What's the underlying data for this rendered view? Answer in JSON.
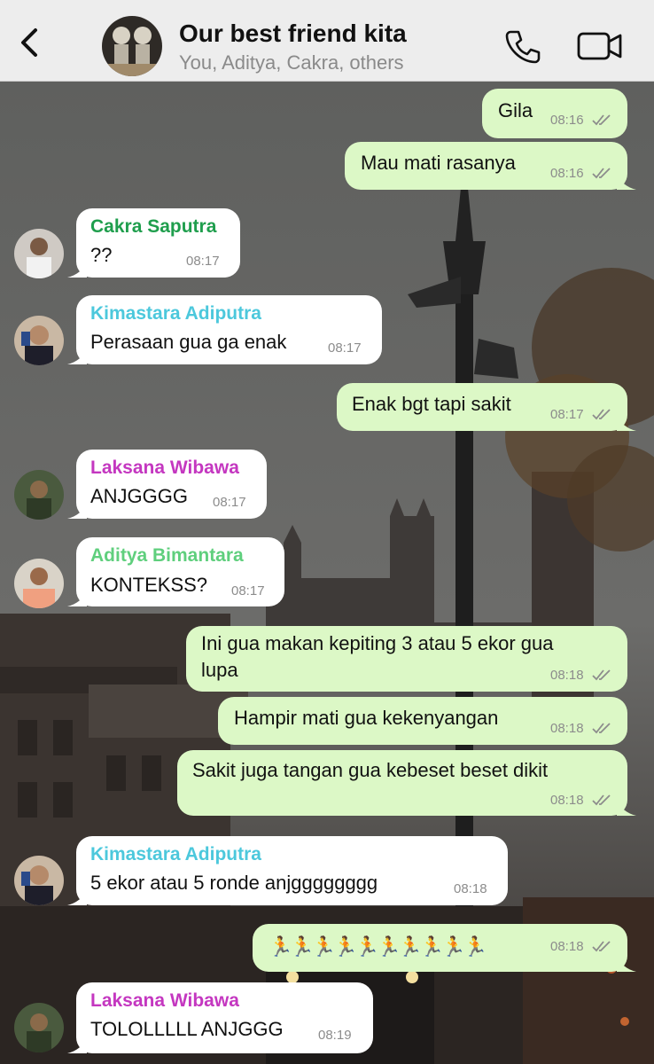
{
  "header": {
    "title": "Our best friend kita",
    "subtitle": "You, Aditya, Cakra, others",
    "icons": [
      "chevron-left-icon",
      "group-avatar",
      "phone-icon",
      "video-camera-icon"
    ]
  },
  "colors": {
    "header_bg": "#ededed",
    "outgoing_bubble": "#dcf8c6",
    "incoming_bubble": "#ffffff",
    "green_name": "#1f9e4d",
    "cyan_name": "#4cc8dc",
    "magenta_name": "#c437c0",
    "lightgreen_name": "#5fcf7d"
  },
  "messages": [
    {
      "dir": "out",
      "text": "Gila",
      "time": "08:16",
      "read": true
    },
    {
      "dir": "out",
      "text": "Mau mati rasanya",
      "time": "08:16",
      "read": true
    },
    {
      "dir": "in",
      "sender": "Cakra Saputra",
      "text": "??",
      "time": "08:17"
    },
    {
      "dir": "in",
      "sender": "Kimastara Adiputra",
      "text": "Perasaan gua ga enak",
      "time": "08:17"
    },
    {
      "dir": "out",
      "text": "Enak bgt tapi sakit",
      "time": "08:17",
      "read": true
    },
    {
      "dir": "in",
      "sender": "Laksana Wibawa",
      "text": "ANJGGGG",
      "time": "08:17"
    },
    {
      "dir": "in",
      "sender": "Aditya Bimantara",
      "text": "KONTEKSS?",
      "time": "08:17"
    },
    {
      "dir": "out",
      "text_line1": "Ini gua makan kepiting 3 atau 5 ekor gua",
      "text_line2": "lupa",
      "time": "08:18",
      "read": true
    },
    {
      "dir": "out",
      "text": "Hampir mati gua kekenyangan",
      "time": "08:18",
      "read": true
    },
    {
      "dir": "out",
      "text": "Sakit juga tangan gua kebeset beset dikit",
      "time": "08:18",
      "read": true
    },
    {
      "dir": "in",
      "sender": "Kimastara Adiputra",
      "text": "5 ekor atau 5 ronde anjgggggggg",
      "time": "08:18"
    },
    {
      "dir": "out",
      "text": "🏃🏃🏃🏃🏃🏃🏃🏃🏃🏃",
      "time": "08:18",
      "read": true
    },
    {
      "dir": "in",
      "sender": "Laksana Wibawa",
      "text": "TOLOLLLLL ANJGGG",
      "time": "08:19"
    }
  ]
}
